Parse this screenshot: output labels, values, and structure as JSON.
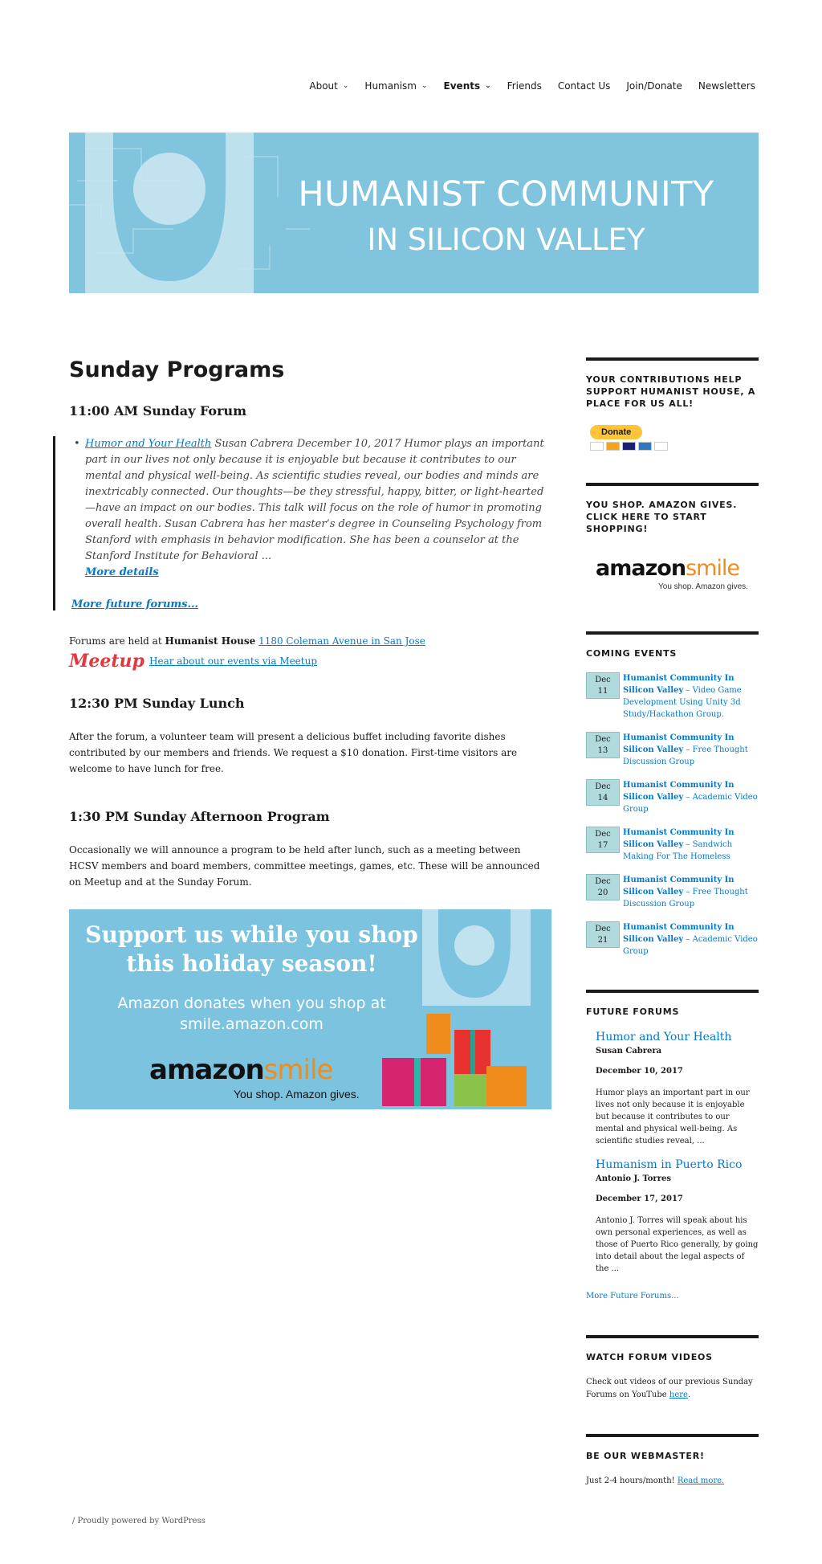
{
  "nav": {
    "items": [
      {
        "label": "About",
        "has_menu": true
      },
      {
        "label": "Humanism",
        "has_menu": true
      },
      {
        "label": "Events",
        "has_menu": true,
        "active": true
      },
      {
        "label": "Friends",
        "has_menu": false
      },
      {
        "label": "Contact Us",
        "has_menu": false
      },
      {
        "label": "Join/Donate",
        "has_menu": false
      },
      {
        "label": "Newsletters",
        "has_menu": false
      }
    ]
  },
  "banner": {
    "title": "HUMANIST COMMUNITY",
    "subtitle": "IN SILICON VALLEY"
  },
  "main": {
    "page_title": "Sunday Programs",
    "forum_heading": "11:00 AM Sunday Forum",
    "forum_link": "Humor and Your Health",
    "forum_text": " Susan Cabrera December 10, 2017 Humor plays an important part in our lives not only because it is enjoyable but because it contributes to our mental and physical well-being. As scientific studies reveal, our bodies and minds are inextricably connected. Our thoughts—be they stressful, happy, bitter, or light-hearted—have an impact on our bodies. This talk will focus on the role of humor in promoting overall health. Susan Cabrera has her master’s degree in Counseling Psychology from Stanford with emphasis in behavior modification. She has been a counselor at the Stanford Institute for Behavioral ...",
    "forum_more": "More details",
    "more_forums": "More future forums...",
    "held_at_prefix": "Forums are held at ",
    "held_at_place": "Humanist House",
    "held_at_address": "1180 Coleman Avenue in San Jose",
    "meetup_logo": "Meetup",
    "meetup_link": "Hear about our events via Meetup",
    "lunch_heading": "12:30 PM Sunday Lunch",
    "lunch_text": "After the forum, a volunteer team will present a delicious buffet including favorite dishes contributed by our members and friends. We request a $10 donation. First-time visitors are welcome to have lunch for free.",
    "afternoon_heading": "1:30 PM Sunday Afternoon Program",
    "afternoon_text": "Occasionally we will announce a program to be held after lunch, such as a meeting between HCSV members and board members, committee meetings, games, etc. These will be announced on Meetup and at the Sunday Forum.",
    "promo": {
      "line1": "Support us while you shop this holiday season!",
      "line2": "Amazon donates when you shop at smile.amazon.com",
      "logo_main": "amazon",
      "logo_smile": "smile",
      "tagline": "You shop. Amazon gives."
    }
  },
  "sidebar": {
    "donate": {
      "title": "YOUR CONTRIBUTIONS HELP SUPPORT HUMANIST HOUSE, A PLACE FOR US ALL!",
      "button": "Donate"
    },
    "amazon": {
      "title": "YOU SHOP. AMAZON GIVES. CLICK HERE TO START SHOPPING!",
      "logo_main": "amazon",
      "logo_smile": "smile",
      "tagline": "You shop. Amazon gives."
    },
    "coming": {
      "title": "COMING EVENTS",
      "events": [
        {
          "month": "Dec",
          "day": "11",
          "org": "Humanist Community In Silicon Valley",
          "name": " – Video Game Development Using Unity 3d Study/Hackathon Group."
        },
        {
          "month": "Dec",
          "day": "13",
          "org": "Humanist Community In Silicon Valley",
          "name": " – Free Thought Discussion Group"
        },
        {
          "month": "Dec",
          "day": "14",
          "org": "Humanist Community In Silicon Valley",
          "name": " – Academic Video Group"
        },
        {
          "month": "Dec",
          "day": "17",
          "org": "Humanist Community In Silicon Valley",
          "name": " – Sandwich Making For The Homeless"
        },
        {
          "month": "Dec",
          "day": "20",
          "org": "Humanist Community In Silicon Valley",
          "name": " – Free Thought Discussion Group"
        },
        {
          "month": "Dec",
          "day": "21",
          "org": "Humanist Community In Silicon Valley",
          "name": " – Academic Video Group"
        }
      ]
    },
    "future": {
      "title": "FUTURE FORUMS",
      "items": [
        {
          "title": "Humor and Your Health",
          "speaker": "Susan Cabrera",
          "date": "December 10, 2017",
          "desc": "Humor plays an important part in our lives not only because it is enjoyable but because it contributes to our mental and physical well-being. As scientific studies reveal, ..."
        },
        {
          "title": "Humanism in Puerto Rico",
          "speaker": "Antonio J. Torres",
          "date": "December 17, 2017",
          "desc": "Antonio J. Torres will speak about his own personal experiences, as well as those of Puerto Rico generally, by going into detail about the legal aspects of the ..."
        }
      ],
      "more": "More Future Forums..."
    },
    "videos": {
      "title": "WATCH FORUM VIDEOS",
      "text": "Check out videos of our previous Sunday Forums on YouTube ",
      "link": "here",
      "after": "."
    },
    "webmaster": {
      "title": "BE OUR WEBMASTER!",
      "text": "Just 2-4 hours/month! ",
      "link": "Read more."
    }
  },
  "footer": {
    "text": "/ Proudly powered by WordPress"
  },
  "colors": {
    "link": "#007acc",
    "banner": "#80c4dd",
    "donate": "#ffc439",
    "amazon_orange": "#f08c1b"
  }
}
